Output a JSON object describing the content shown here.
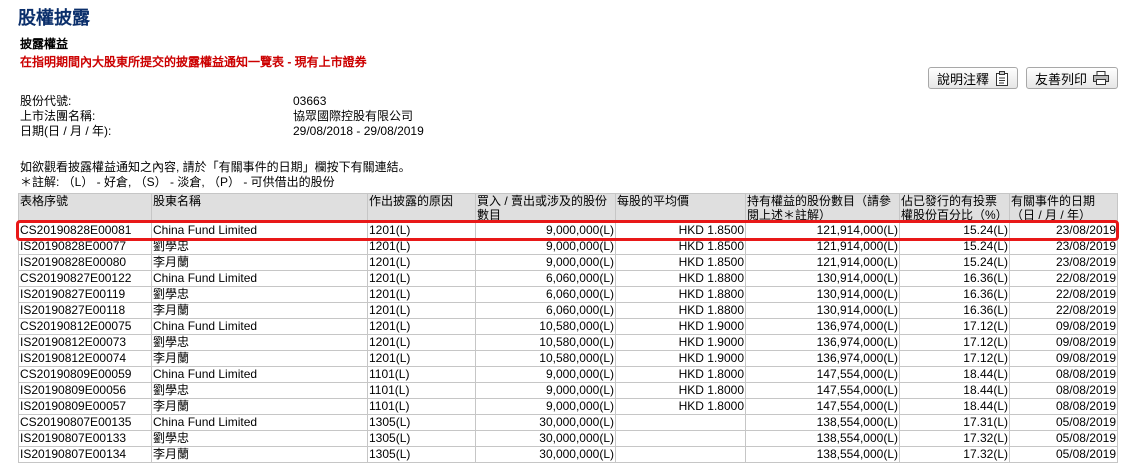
{
  "header": {
    "page_title": "股權披露",
    "section_heading": "披露權益",
    "subtitle": "在指明期間內大股東所提交的披露權益通知一覽表 - 現有上市證券"
  },
  "toolbar": {
    "explain_label": "說明注釋",
    "print_label": "友善列印"
  },
  "info": [
    {
      "label": "股份代號:",
      "value": "03663"
    },
    {
      "label": "上市法團名稱:",
      "value": "協眾國際控股有限公司"
    },
    {
      "label": "日期(日 / 月 / 年):",
      "value": "29/08/2018 - 29/08/2019"
    }
  ],
  "instructions": {
    "line1": "如欲觀看披露權益通知之內容, 請於「有關事件的日期」欄按下有關連結。",
    "line2": "＊註解: （L） - 好倉, （S） - 淡倉, （P） - 可供借出的股份"
  },
  "table": {
    "headers": [
      "表格序號",
      "股東名稱",
      "作出披露的原因",
      "買入 / 賣出或涉及的股份數目",
      "每股的平均價",
      "持有權益的股份數目（請參閱上述＊註解）",
      "佔已發行的有投票權股份百分比（%）",
      "有關事件的日期（日 / 月 / 年）"
    ],
    "rows": [
      [
        "CS20190828E00081",
        "China Fund Limited",
        "1201(L)",
        "9,000,000(L)",
        "HKD 1.8500",
        "121,914,000(L)",
        "15.24(L)",
        "23/08/2019"
      ],
      [
        "IS20190828E00077",
        "劉學忠",
        "1201(L)",
        "9,000,000(L)",
        "HKD 1.8500",
        "121,914,000(L)",
        "15.24(L)",
        "23/08/2019"
      ],
      [
        "IS20190828E00080",
        "李月蘭",
        "1201(L)",
        "9,000,000(L)",
        "HKD 1.8500",
        "121,914,000(L)",
        "15.24(L)",
        "23/08/2019"
      ],
      [
        "CS20190827E00122",
        "China Fund Limited",
        "1201(L)",
        "6,060,000(L)",
        "HKD 1.8800",
        "130,914,000(L)",
        "16.36(L)",
        "22/08/2019"
      ],
      [
        "IS20190827E00119",
        "劉學忠",
        "1201(L)",
        "6,060,000(L)",
        "HKD 1.8800",
        "130,914,000(L)",
        "16.36(L)",
        "22/08/2019"
      ],
      [
        "IS20190827E00118",
        "李月蘭",
        "1201(L)",
        "6,060,000(L)",
        "HKD 1.8800",
        "130,914,000(L)",
        "16.36(L)",
        "22/08/2019"
      ],
      [
        "CS20190812E00075",
        "China Fund Limited",
        "1201(L)",
        "10,580,000(L)",
        "HKD 1.9000",
        "136,974,000(L)",
        "17.12(L)",
        "09/08/2019"
      ],
      [
        "IS20190812E00073",
        "劉學忠",
        "1201(L)",
        "10,580,000(L)",
        "HKD 1.9000",
        "136,974,000(L)",
        "17.12(L)",
        "09/08/2019"
      ],
      [
        "IS20190812E00074",
        "李月蘭",
        "1201(L)",
        "10,580,000(L)",
        "HKD 1.9000",
        "136,974,000(L)",
        "17.12(L)",
        "09/08/2019"
      ],
      [
        "CS20190809E00059",
        "China Fund Limited",
        "1101(L)",
        "9,000,000(L)",
        "HKD 1.8000",
        "147,554,000(L)",
        "18.44(L)",
        "08/08/2019"
      ],
      [
        "IS20190809E00056",
        "劉學忠",
        "1101(L)",
        "9,000,000(L)",
        "HKD 1.8000",
        "147,554,000(L)",
        "18.44(L)",
        "08/08/2019"
      ],
      [
        "IS20190809E00057",
        "李月蘭",
        "1101(L)",
        "9,000,000(L)",
        "HKD 1.8000",
        "147,554,000(L)",
        "18.44(L)",
        "08/08/2019"
      ],
      [
        "CS20190807E00135",
        "China Fund Limited",
        "1305(L)",
        "30,000,000(L)",
        "",
        "138,554,000(L)",
        "17.31(L)",
        "05/08/2019"
      ],
      [
        "IS20190807E00133",
        "劉學忠",
        "1305(L)",
        "30,000,000(L)",
        "",
        "138,554,000(L)",
        "17.32(L)",
        "05/08/2019"
      ],
      [
        "IS20190807E00134",
        "李月蘭",
        "1305(L)",
        "30,000,000(L)",
        "",
        "138,554,000(L)",
        "17.32(L)",
        "05/08/2019"
      ]
    ]
  },
  "icons": {
    "explain_icon": "clipboard-icon",
    "print_icon": "printer-icon"
  },
  "colors": {
    "title": "#0b2f6b",
    "subtitle": "#cc0000",
    "header_bg": "#dfdfdf",
    "highlight": "#e81818"
  }
}
